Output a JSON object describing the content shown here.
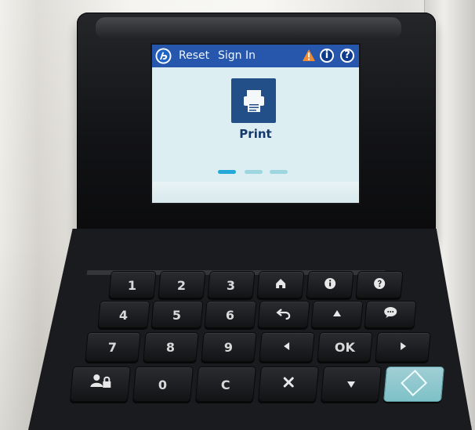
{
  "screen": {
    "top_bar": {
      "logo": "hp-logo",
      "reset_label": "Reset",
      "sign_in_label": "Sign In",
      "warning_icon": "warning-icon",
      "info_icon": "info-icon",
      "help_icon": "help-icon",
      "info_text": "i",
      "help_text": "?"
    },
    "main_tile": {
      "label": "Print",
      "icon": "printer-icon"
    },
    "pager": {
      "active_index": 1,
      "total": 3
    }
  },
  "keypad": {
    "row1": [
      "1",
      "2",
      "3",
      "home-icon",
      "info-circle-icon",
      "help-circle-icon"
    ],
    "row2": [
      "4",
      "5",
      "6",
      "back-icon",
      "up-arrow-icon",
      "chat-icon"
    ],
    "row3": [
      "7",
      "8",
      "9",
      "left-arrow-icon",
      "OK",
      "right-arrow-icon"
    ],
    "row4": [
      "user-lock-icon",
      "0",
      "C",
      "close-icon",
      "down-arrow-icon",
      "start-icon"
    ]
  },
  "colors": {
    "screen_bar": "#2657ad",
    "screen_background": "#dceef2",
    "print_tile": "#234f88",
    "start_key": "#8ecbd1",
    "key_body": "#1f2023"
  }
}
